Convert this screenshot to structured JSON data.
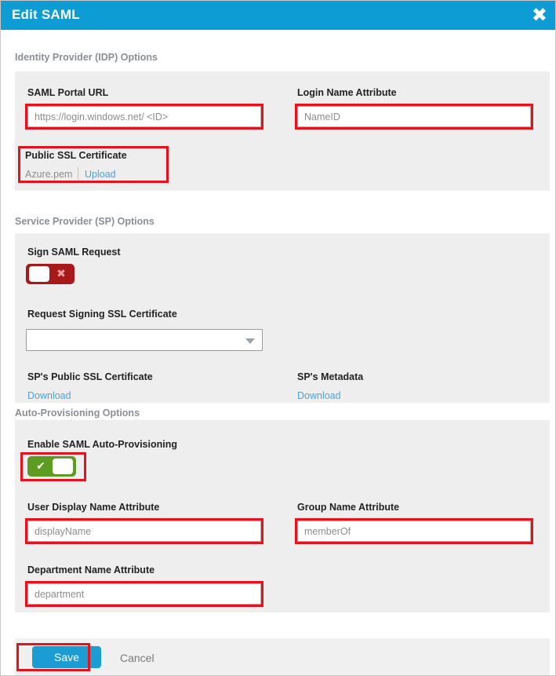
{
  "dialog": {
    "title": "Edit SAML",
    "close_icon": "close-icon"
  },
  "sections": {
    "idp": {
      "header": "Identity Provider (IDP) Options",
      "portal_url_label": "SAML Portal URL",
      "portal_url_value": "https://login.windows.net/ <ID>",
      "login_name_label": "Login Name Attribute",
      "login_name_value": "NameID",
      "public_ssl_label": "Public SSL Certificate",
      "public_ssl_filename": "Azure.pem",
      "public_ssl_upload": "Upload"
    },
    "sp": {
      "header": "Service Provider (SP) Options",
      "sign_request_label": "Sign SAML Request",
      "sign_request_state": "off",
      "sign_request_glyph": "✖",
      "request_signing_label": "Request Signing SSL Certificate",
      "request_signing_value": "",
      "sp_public_cert_label": "SP's Public SSL Certificate",
      "sp_public_cert_link": "Download",
      "sp_metadata_label": "SP's Metadata",
      "sp_metadata_link": "Download"
    },
    "autoprov": {
      "header": "Auto-Provisioning Options",
      "enable_label": "Enable SAML Auto-Provisioning",
      "enable_state": "on",
      "enable_glyph": "✔",
      "user_display_label": "User Display Name Attribute",
      "user_display_value": "displayName",
      "group_name_label": "Group Name Attribute",
      "group_name_value": "memberOf",
      "department_label": "Department Name Attribute",
      "department_value": "department"
    }
  },
  "footer": {
    "save_label": "Save",
    "cancel_label": "Cancel"
  },
  "colors": {
    "header_blue": "#0d9dd4",
    "save_blue": "#1b9dd4",
    "link_blue": "#4aa3dc",
    "annotation_red": "#e3121c",
    "toggle_off_red": "#a81a1a",
    "toggle_on_green": "#5d9c21",
    "panel_gray": "#eeeeee"
  }
}
